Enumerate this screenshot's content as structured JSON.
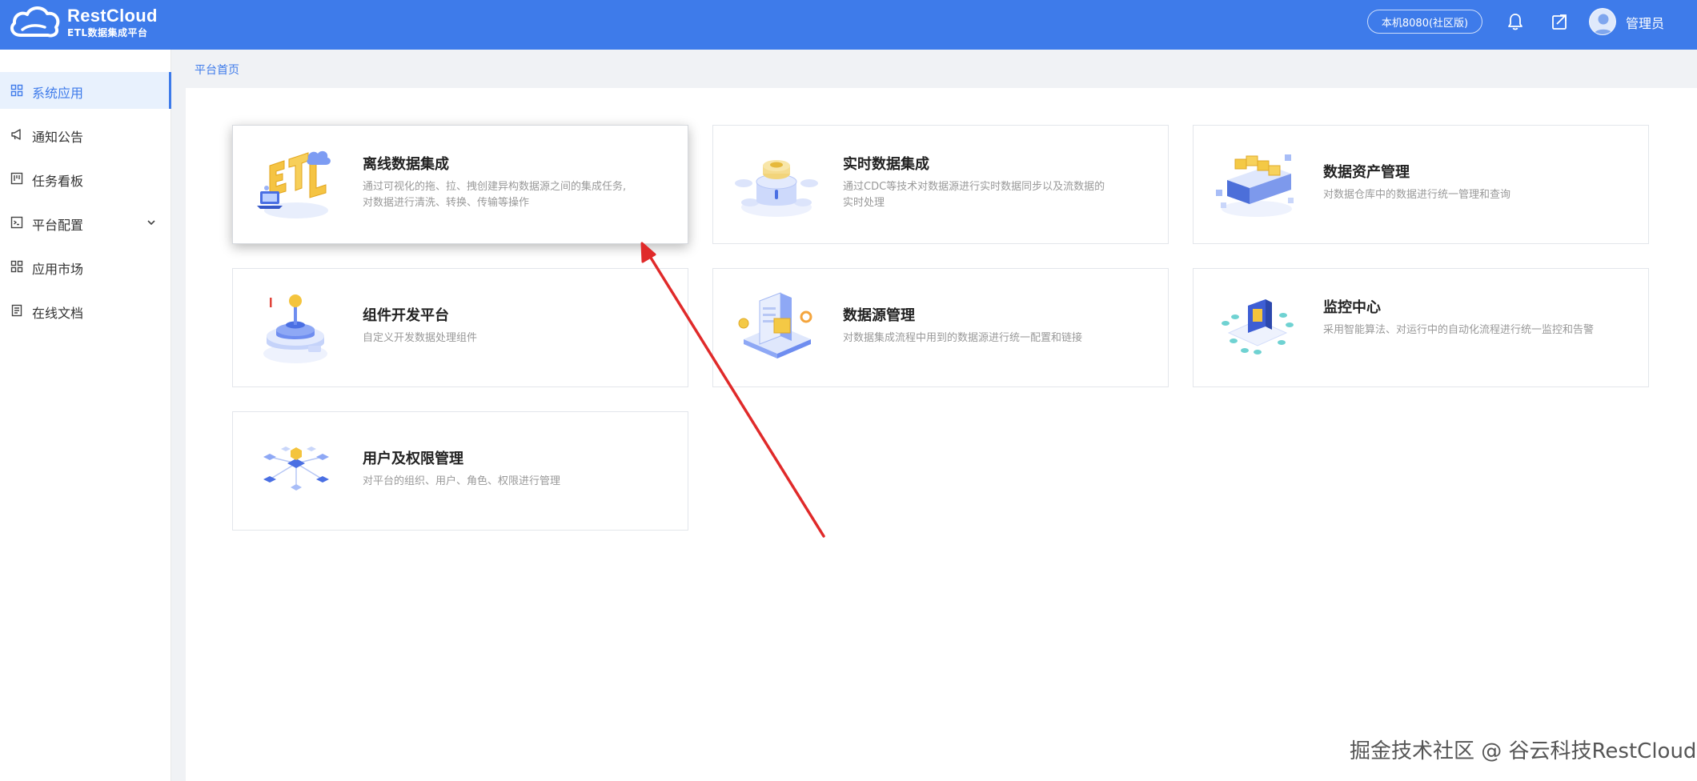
{
  "header": {
    "logo_title": "RestCloud",
    "logo_subtitle": "ETL数据集成平台",
    "env_label": "本机8080(社区版)",
    "user_name": "管理员",
    "icons": [
      "bell-icon",
      "share-icon",
      "avatar"
    ],
    "color": "#3e7bea"
  },
  "sidebar": {
    "items": [
      {
        "label": "系统应用",
        "icon": "grid-icon",
        "active": true
      },
      {
        "label": "通知公告",
        "icon": "megaphone-icon"
      },
      {
        "label": "任务看板",
        "icon": "kanban-icon"
      },
      {
        "label": "平台配置",
        "icon": "terminal-icon",
        "expandable": true
      },
      {
        "label": "应用市场",
        "icon": "grid-icon"
      },
      {
        "label": "在线文档",
        "icon": "document-icon"
      }
    ]
  },
  "breadcrumb": "平台首页",
  "cards": [
    {
      "title": "离线数据集成",
      "desc": "通过可视化的拖、拉、拽创建异构数据源之间的集成任务,对数据进行清洗、转换、传输等操作",
      "icon": "etl-illustration"
    },
    {
      "title": "实时数据集成",
      "desc": "通过CDC等技术对数据源进行实时数据同步以及流数据的实时处理",
      "icon": "realtime-illustration"
    },
    {
      "title": "数据资产管理",
      "desc": "对数据仓库中的数据进行统一管理和查询",
      "icon": "asset-illustration"
    },
    {
      "title": "组件开发平台",
      "desc": "自定义开发数据处理组件",
      "icon": "component-illustration"
    },
    {
      "title": "数据源管理",
      "desc": "对数据集成流程中用到的数据源进行统一配置和链接",
      "icon": "datasource-illustration"
    },
    {
      "title": "监控中心",
      "desc": "采用智能算法、对运行中的自动化流程进行统一监控和告警",
      "icon": "monitor-illustration"
    },
    {
      "title": "用户及权限管理",
      "desc": "对平台的组织、用户、角色、权限进行管理",
      "icon": "user-permission-illustration"
    }
  ],
  "watermark": "掘金技术社区 @ 谷云科技RestCloud",
  "colors": {
    "accent": "#3e7bea",
    "annotation_arrow": "#e02a2a"
  }
}
